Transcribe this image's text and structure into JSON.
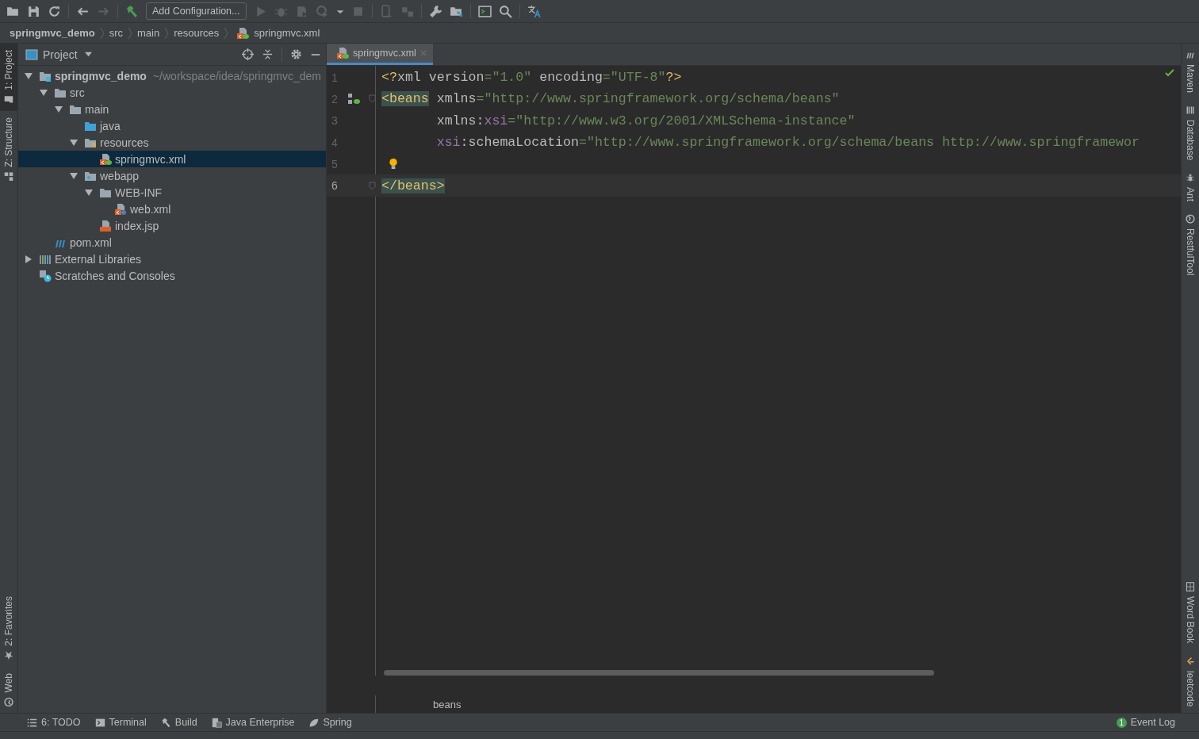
{
  "toolbar": [
    {
      "kind": "open",
      "disabled": false
    },
    {
      "kind": "save",
      "disabled": false
    },
    {
      "kind": "sync",
      "disabled": false
    },
    {
      "kind": "separator"
    },
    {
      "kind": "back",
      "disabled": false
    },
    {
      "kind": "forward",
      "disabled": true
    },
    {
      "kind": "separator"
    },
    {
      "kind": "build",
      "disabled": false
    },
    {
      "kind": "config",
      "label": "Add Configuration...",
      "disabled": false
    },
    {
      "kind": "run",
      "disabled": true
    },
    {
      "kind": "debug",
      "disabled": true
    },
    {
      "kind": "coverage",
      "disabled": true
    },
    {
      "kind": "profile",
      "disabled": true
    },
    {
      "kind": "caret",
      "disabled": false
    },
    {
      "kind": "stop",
      "disabled": true
    },
    {
      "kind": "separator"
    },
    {
      "kind": "device",
      "disabled": true
    },
    {
      "kind": "plugin",
      "disabled": true
    },
    {
      "kind": "separator"
    },
    {
      "kind": "wrench",
      "disabled": false
    },
    {
      "kind": "structure",
      "disabled": false
    },
    {
      "kind": "separator"
    },
    {
      "kind": "terminal",
      "disabled": false
    },
    {
      "kind": "search",
      "disabled": false
    },
    {
      "kind": "separator"
    },
    {
      "kind": "translate",
      "disabled": false
    }
  ],
  "breadcrumb": [
    {
      "label": "springmvc_demo",
      "kind": "module"
    },
    {
      "label": "src",
      "kind": "plain"
    },
    {
      "label": "main",
      "kind": "plain"
    },
    {
      "label": "resources",
      "kind": "plain"
    },
    {
      "label": "springmvc.xml",
      "kind": "spring-xml"
    }
  ],
  "left_strip": {
    "top": [
      {
        "label": "1: Project",
        "kind": "project",
        "selected": true
      },
      {
        "label": "Z: Structure",
        "kind": "structure",
        "selected": false
      }
    ],
    "bottom": [
      {
        "label": "2: Favorites",
        "kind": "star",
        "selected": false
      },
      {
        "label": "Web",
        "kind": "globe",
        "selected": false
      }
    ]
  },
  "project_panel": {
    "title": "Project",
    "tree": [
      {
        "label": "springmvc_demo",
        "hint": "~/workspace/idea/springmvc_dem",
        "kind": "module",
        "expanded": true,
        "selected": false,
        "children": [
          {
            "label": "src",
            "kind": "folder",
            "expanded": true,
            "selected": false,
            "children": [
              {
                "label": "main",
                "kind": "folder",
                "expanded": true,
                "selected": false,
                "children": [
                  {
                    "label": "java",
                    "kind": "source-folder",
                    "selected": false
                  },
                  {
                    "label": "resources",
                    "kind": "resources-folder",
                    "expanded": true,
                    "selected": false,
                    "children": [
                      {
                        "label": "springmvc.xml",
                        "kind": "spring-xml",
                        "selected": true
                      }
                    ]
                  },
                  {
                    "label": "webapp",
                    "kind": "web-folder",
                    "expanded": true,
                    "selected": false,
                    "children": [
                      {
                        "label": "WEB-INF",
                        "kind": "folder",
                        "expanded": true,
                        "selected": false,
                        "children": [
                          {
                            "label": "web.xml",
                            "kind": "web-xml",
                            "selected": false
                          }
                        ]
                      },
                      {
                        "label": "index.jsp",
                        "kind": "jsp",
                        "selected": false
                      }
                    ]
                  }
                ]
              }
            ]
          },
          {
            "label": "pom.xml",
            "kind": "maven",
            "selected": false
          }
        ]
      },
      {
        "label": "External Libraries",
        "kind": "libraries",
        "expanded": false,
        "selected": false
      },
      {
        "label": "Scratches and Consoles",
        "kind": "scratches",
        "selected": false
      }
    ]
  },
  "editor": {
    "tabs": [
      {
        "label": "springmvc.xml",
        "selected": true
      }
    ],
    "lines": [
      {
        "number": "1",
        "current": false,
        "kind": "plain",
        "tokens": [
          {
            "kind": "tag",
            "text": "<?"
          },
          {
            "kind": "attr",
            "text": "xml "
          },
          {
            "kind": "attr",
            "text": "version"
          },
          {
            "kind": "value",
            "text": "=\"1.0\""
          },
          {
            "kind": "attr",
            "text": " encoding"
          },
          {
            "kind": "value",
            "text": "=\"UTF-8\""
          },
          {
            "kind": "tag",
            "text": "?>"
          }
        ]
      },
      {
        "number": "2",
        "current": false,
        "kind": "bean-gutter",
        "tokens": [
          {
            "kind": "tag",
            "text": "<beans",
            "matched": true
          },
          {
            "kind": "attr",
            "text": " xmlns"
          },
          {
            "kind": "value",
            "text": "=\"http://www.springframework.org/schema/beans\""
          }
        ]
      },
      {
        "number": "3",
        "current": false,
        "kind": "plain",
        "tokens": [
          {
            "kind": "attr",
            "text": "       xmlns:"
          },
          {
            "kind": "ns",
            "text": "xsi"
          },
          {
            "kind": "value",
            "text": "=\"http://www.w3.org/2001/XMLSchema-instance\""
          }
        ]
      },
      {
        "number": "4",
        "current": false,
        "kind": "plain",
        "tokens": [
          {
            "kind": "ns",
            "text": "       xsi"
          },
          {
            "kind": "attr",
            "text": ":schemaLocation"
          },
          {
            "kind": "value",
            "text": "=\"http://www.springframework.org/schema/beans http://www.springframewor"
          }
        ]
      },
      {
        "number": "5",
        "current": false,
        "kind": "intention"
      },
      {
        "number": "6",
        "current": true,
        "kind": "plain",
        "tokens": [
          {
            "kind": "tag",
            "text": "</beans>",
            "matched": true
          }
        ]
      }
    ],
    "footer": "beans"
  },
  "right_strip": {
    "top": [
      {
        "label": "Maven",
        "kind": "maven"
      },
      {
        "label": "Database",
        "kind": "database"
      },
      {
        "label": "Ant",
        "kind": "ant"
      },
      {
        "label": "RestfulTool",
        "kind": "globe"
      }
    ],
    "bottom": [
      {
        "label": "Word Book",
        "kind": "book"
      },
      {
        "label": "leetcode",
        "kind": "leetcode"
      }
    ]
  },
  "tool_tabs": [
    {
      "label": "6: TODO",
      "kind": "todo"
    },
    {
      "label": "Terminal",
      "kind": "terminal"
    },
    {
      "label": "Build",
      "kind": "build"
    },
    {
      "label": "Java Enterprise",
      "kind": "enterprise"
    },
    {
      "label": "Spring",
      "kind": "spring"
    }
  ],
  "event_log": {
    "label": "Event Log",
    "count": "1"
  }
}
